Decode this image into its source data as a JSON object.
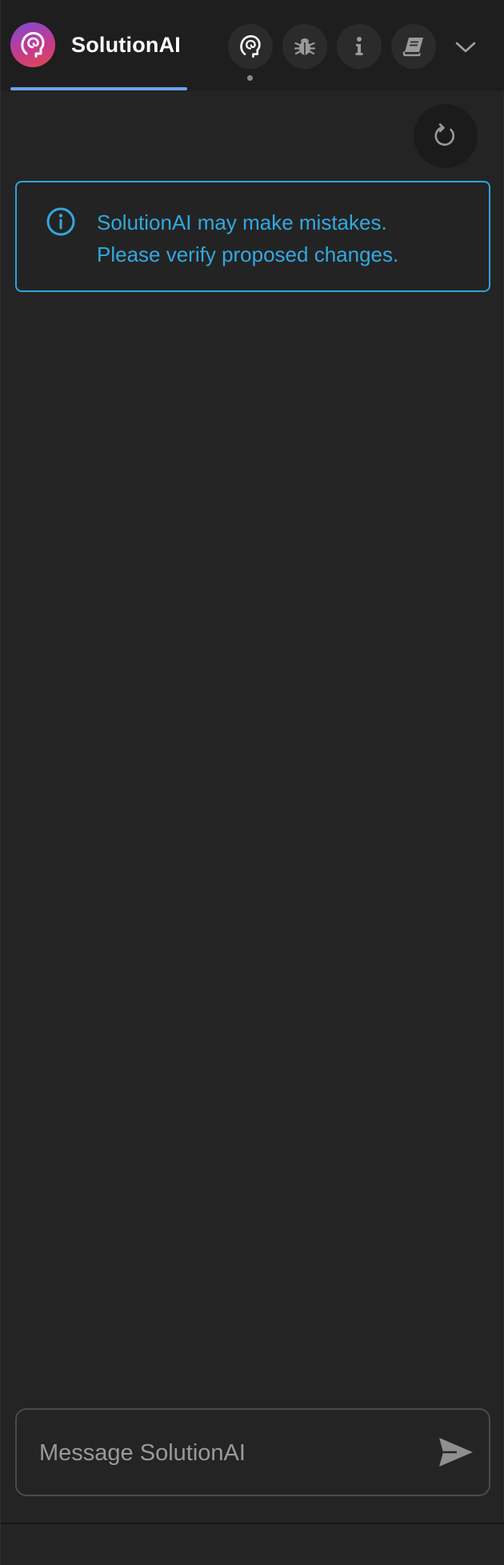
{
  "app": {
    "name": "SolutionAI"
  },
  "header": {
    "nav_icons": [
      "assistant-head-icon",
      "bug-icon",
      "info-icon",
      "book-icon"
    ],
    "menu_icon": "chevron-down-icon"
  },
  "toolbar": {
    "refresh_icon": "refresh-icon"
  },
  "notice": {
    "line1": "SolutionAI may make mistakes.",
    "line2": "Please verify proposed changes."
  },
  "composer": {
    "placeholder": "Message SolutionAI",
    "value": "",
    "send_icon": "send-icon"
  },
  "colors": {
    "accent_blue": "#33a8e0",
    "tab_underline": "#6ea2f0",
    "background": "#242424"
  }
}
